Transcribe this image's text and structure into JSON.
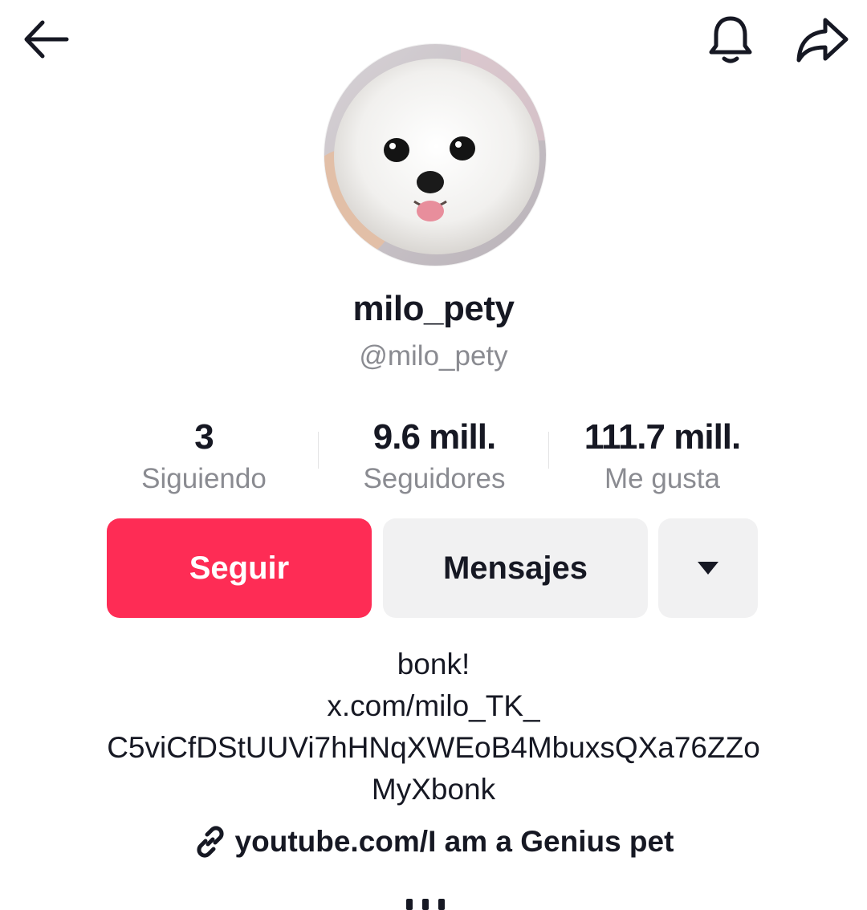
{
  "header": {
    "back_icon": "arrow-left-icon",
    "notification_icon": "bell-icon",
    "share_icon": "share-arrow-icon"
  },
  "profile": {
    "display_name": "milo_pety",
    "handle": "@milo_pety"
  },
  "stats": [
    {
      "value": "3",
      "label": "Siguiendo"
    },
    {
      "value": "9.6 mill.",
      "label": "Seguidores"
    },
    {
      "value": "111.7 mill.",
      "label": "Me gusta"
    }
  ],
  "actions": {
    "follow_label": "Seguir",
    "message_label": "Mensajes",
    "more_icon": "caret-down-icon"
  },
  "bio": {
    "lines": [
      "bonk!",
      "x.com/milo_TK_",
      "C5viCfDStUUVi7hHNqXWEoB4MbuxsQXa76ZZo",
      "MyXbonk"
    ]
  },
  "link": {
    "icon": "link-icon",
    "text": "youtube.com/I am a Genius pet"
  },
  "colors": {
    "accent": "#fe2c55",
    "secondary_button": "#f1f1f2",
    "muted_text": "#8a8b91",
    "text": "#161823"
  }
}
